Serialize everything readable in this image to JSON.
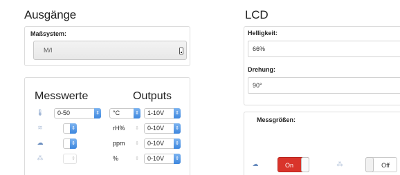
{
  "left": {
    "title": "Ausgänge",
    "masssystem": {
      "label": "Maßsystem:",
      "value": "M/I"
    },
    "table": {
      "head_measurements": "Messwerte",
      "head_outputs": "Outputs",
      "rows": [
        {
          "icon": "thermometer-icon",
          "glyph": "🌡",
          "range": "0-50",
          "unit": "°C",
          "output": "1-10V"
        },
        {
          "icon": "humidity-icon",
          "glyph": "≋",
          "range": "",
          "unit": "rH%",
          "output": "0-10V"
        },
        {
          "icon": "co2-icon",
          "glyph": "☁",
          "range": "",
          "unit": "ppm",
          "output": "0-10V"
        },
        {
          "icon": "voc-icon",
          "glyph": "⁂",
          "range": "",
          "unit": "%",
          "output": "0-10V"
        }
      ]
    }
  },
  "right": {
    "title": "LCD",
    "brightness": {
      "label": "Helligkeit:",
      "value": "66%"
    },
    "rotation": {
      "label": "Drehung:",
      "value": "90°"
    },
    "measurements": {
      "label": "Messgrößen:",
      "toggle_on": "On",
      "toggle_off": "Off"
    }
  }
}
